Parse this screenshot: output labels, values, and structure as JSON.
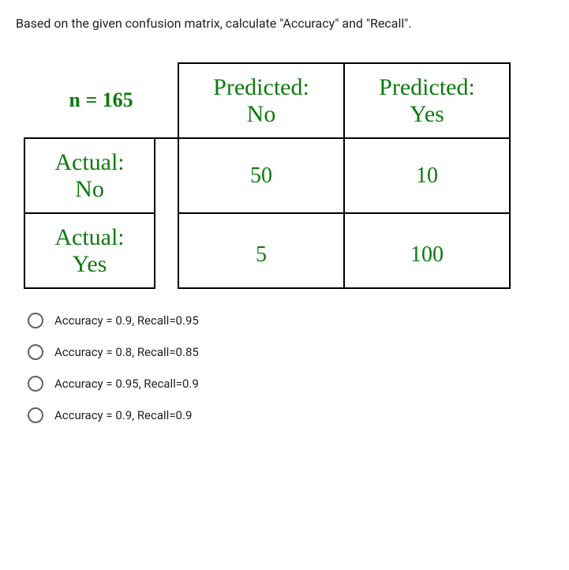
{
  "question": "Based on the given confusion matrix, calculate \"Accuracy\" and \"Recall\".",
  "matrix": {
    "n_label": "n = 165",
    "pred_no": "Predicted: No",
    "pred_yes": "Predicted: Yes",
    "actual_no": "Actual: No",
    "actual_yes": "Actual: Yes",
    "val_tn": "50",
    "val_fp": "10",
    "val_fn": "5",
    "val_tp": "100"
  },
  "options": [
    {
      "label": "Accuracy = 0.9, Recall=0.95"
    },
    {
      "label": "Accuracy = 0.8, Recall=0.85"
    },
    {
      "label": "Accuracy = 0.95, Recall=0.9"
    },
    {
      "label": "Accuracy = 0.9, Recall=0.9"
    }
  ]
}
